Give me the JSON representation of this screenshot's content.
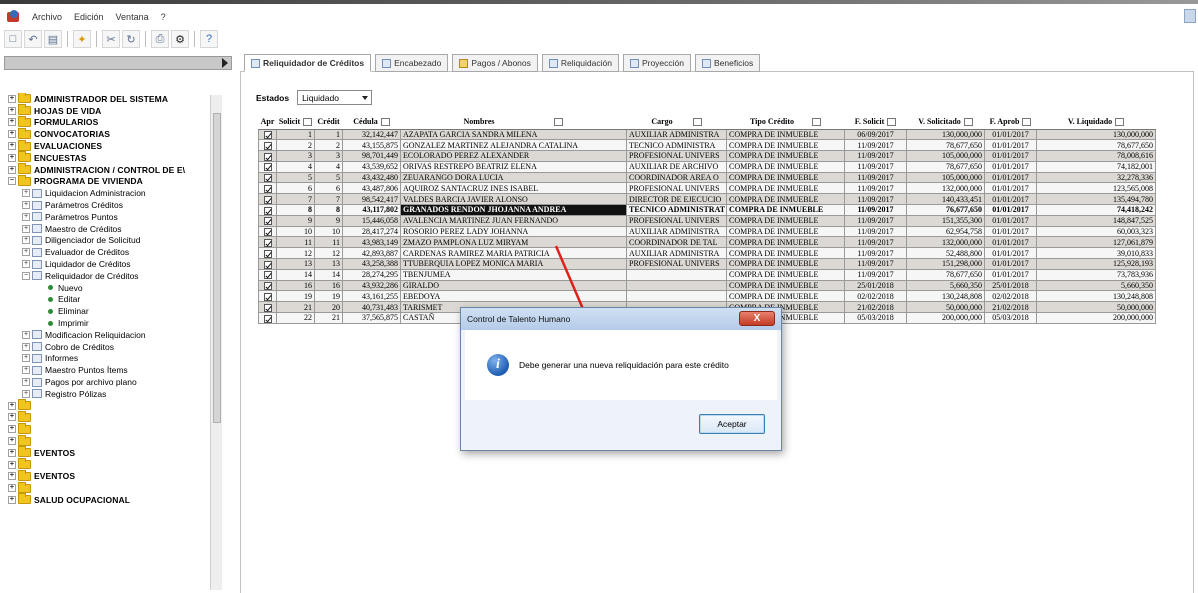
{
  "menubar": {
    "items": [
      "Archivo",
      "Edición",
      "Ventana",
      "?"
    ]
  },
  "toolbar": {
    "icons": [
      "save-icon",
      "undo-icon",
      "copy-icon",
      "new-icon",
      "cut-icon",
      "refresh-icon",
      "print-icon",
      "settings-icon",
      "help-icon"
    ]
  },
  "tree": {
    "items": [
      "ADMINISTRADOR DEL SISTEMA",
      "HOJAS DE VIDA",
      "FORMULARIOS",
      "CONVOCATORIAS",
      "EVALUACIONES",
      "ENCUESTAS",
      "ADMINISTRACION / CONTROL DE E\\",
      "PROGRAMA DE VIVIENDA",
      "Liquidacion Administracion",
      "Parámetros Créditos",
      "Parámetros Puntos",
      "Maestro de Créditos",
      "Diligenciador de Solicitud",
      "Evaluador de Créditos",
      "Liquidador de Créditos",
      "Reliquidador de Créditos",
      "Nuevo",
      "Editar",
      "Eliminar",
      "Imprimir",
      "Modificacion Reliquidacion",
      "Cobro de Créditos",
      "Informes",
      "Maestro Puntos Ítems",
      "Pagos por archivo plano",
      "Registro Pólizas",
      "",
      "",
      "",
      "",
      "EVENTOS",
      "",
      "EVENTOS",
      "",
      "SALUD OCUPACIONAL"
    ]
  },
  "tabs": [
    {
      "label": "Reliquidador de Créditos",
      "active": true
    },
    {
      "label": "Encabezado",
      "active": false
    },
    {
      "label": "Pagos / Abonos",
      "active": false
    },
    {
      "label": "Reliquidación",
      "active": false
    },
    {
      "label": "Proyección",
      "active": false
    },
    {
      "label": "Beneficios",
      "active": false
    }
  ],
  "filter": {
    "label": "Estados",
    "selected": "Liquidado"
  },
  "grid": {
    "columns": [
      "Apr",
      "Solicit",
      "Crédit",
      "Cédula",
      "Nombres",
      "Cargo",
      "Tipo Crédito",
      "F. Solicit",
      "V. Solicitado",
      "F. Aprob",
      "V. Liquidado"
    ],
    "rows": [
      [
        "1",
        "1",
        "32,142,447",
        "AZAPATA GARCIA SANDRA MILENA",
        "AUXILIAR ADMINISTRA",
        "COMPRA DE INMUEBLE",
        "06/09/2017",
        "130,000,000",
        "01/01/2017",
        "130,000,000"
      ],
      [
        "2",
        "2",
        "43,155,875",
        "GONZALEZ MARTINEZ ALEJANDRA CATALINA",
        "TECNICO ADMINISTRA",
        "COMPRA DE INMUEBLE",
        "11/09/2017",
        "78,677,650",
        "01/01/2017",
        "78,677,650"
      ],
      [
        "3",
        "3",
        "98,701,449",
        "ECOLORADO PEREZ ALEXANDER",
        "PROFESIONAL UNIVERS",
        "COMPRA DE INMUEBLE",
        "11/09/2017",
        "105,000,000",
        "01/01/2017",
        "78,008,616"
      ],
      [
        "4",
        "4",
        "43,539,652",
        "ORIVAS RESTREPO BEATRIZ ELENA",
        "AUXILIAR DE ARCHIVO",
        "COMPRA DE INMUEBLE",
        "11/09/2017",
        "78,677,650",
        "01/01/2017",
        "74,182,001"
      ],
      [
        "5",
        "5",
        "43,432,480",
        "ZEUARANGO DORA LUCIA",
        "COORDINADOR AREA O",
        "COMPRA DE INMUEBLE",
        "11/09/2017",
        "105,000,000",
        "01/01/2017",
        "32,278,336"
      ],
      [
        "6",
        "6",
        "43,487,806",
        "AQUIROZ SANTACRUZ INES ISABEL",
        "PROFESIONAL UNIVERS",
        "COMPRA DE INMUEBLE",
        "11/09/2017",
        "132,000,000",
        "01/01/2017",
        "123,565,008"
      ],
      [
        "7",
        "7",
        "98,542,417",
        "VALDES BARCIA JAVIER ALONSO",
        "DIRECTOR DE EJECUCIO",
        "COMPRA DE INMUEBLE",
        "11/09/2017",
        "140,433,451",
        "01/01/2017",
        "135,494,780"
      ],
      [
        "8",
        "8",
        "43,117,802",
        "GRANADOS RENDON JHOJANNA ANDREA",
        "TECNICO ADMINISTRAT",
        "COMPRA DE INMUEBLE",
        "11/09/2017",
        "76,677,650",
        "01/01/2017",
        "74,418,242"
      ],
      [
        "9",
        "9",
        "15,446,058",
        "AVALENCIA MARTINEZ JUAN FERNANDO",
        "PROFESIONAL UNIVERS",
        "COMPRA DE INMUEBLE",
        "11/09/2017",
        "151,355,300",
        "01/01/2017",
        "148,847,525"
      ],
      [
        "10",
        "10",
        "28,417,274",
        "ROSORIO PEREZ LADY JOHANNA",
        "AUXILIAR ADMINISTRA",
        "COMPRA DE INMUEBLE",
        "11/09/2017",
        "62,954,758",
        "01/01/2017",
        "60,003,323"
      ],
      [
        "11",
        "11",
        "43,983,149",
        "ZMAZO PAMPLONA LUZ MIRYAM",
        "COORDINADOR DE TAL",
        "COMPRA DE INMUEBLE",
        "11/09/2017",
        "132,000,000",
        "01/01/2017",
        "127,061,879"
      ],
      [
        "12",
        "12",
        "42,893,887",
        "CARDENAS RAMIREZ MARIA PATRICIA",
        "AUXILIAR ADMINISTRA",
        "COMPRA DE INMUEBLE",
        "11/09/2017",
        "52,488,800",
        "01/01/2017",
        "39,010,833"
      ],
      [
        "13",
        "13",
        "43,258,388",
        "TTUBERQUIA LOPEZ MONICA MARIA",
        "PROFESIONAL UNIVERS",
        "COMPRA DE INMUEBLE",
        "11/09/2017",
        "151,298,000",
        "01/01/2017",
        "125,928,193"
      ],
      [
        "14",
        "14",
        "28,274,295",
        "TBENJUMEA",
        "",
        "COMPRA DE INMUEBLE",
        "11/09/2017",
        "78,677,650",
        "01/01/2017",
        "73,783,936"
      ],
      [
        "16",
        "16",
        "43,932,286",
        "GIRALDO",
        "",
        "COMPRA DE INMUEBLE",
        "25/01/2018",
        "5,660,350",
        "25/01/2018",
        "5,660,350"
      ],
      [
        "19",
        "19",
        "43,161,255",
        "EBEDOYA",
        "",
        "COMPRA DE INMUEBLE",
        "02/02/2018",
        "130,248,808",
        "02/02/2018",
        "130,248,808"
      ],
      [
        "21",
        "20",
        "40,731,483",
        "TARISMET",
        "",
        "COMPRA DE INMUEBLE",
        "21/02/2018",
        "50,000,000",
        "21/02/2018",
        "50,000,000"
      ],
      [
        "22",
        "21",
        "37,565,875",
        "CASTAÑ",
        "",
        "COMPRA DE INMUEBLE",
        "05/03/2018",
        "200,000,000",
        "05/03/2018",
        "200,000,000"
      ]
    ]
  },
  "dialog": {
    "title": "Control de Talento Humano",
    "close_label": "X",
    "message": "Debe generar una nueva reliquidación para este crédito",
    "ok_label": "Aceptar"
  },
  "colors": {
    "accent": "#2f6fb7",
    "row_odd": "#dcd9d4",
    "row_selected": "#111111",
    "annotation_arrow": "#e0201a"
  }
}
